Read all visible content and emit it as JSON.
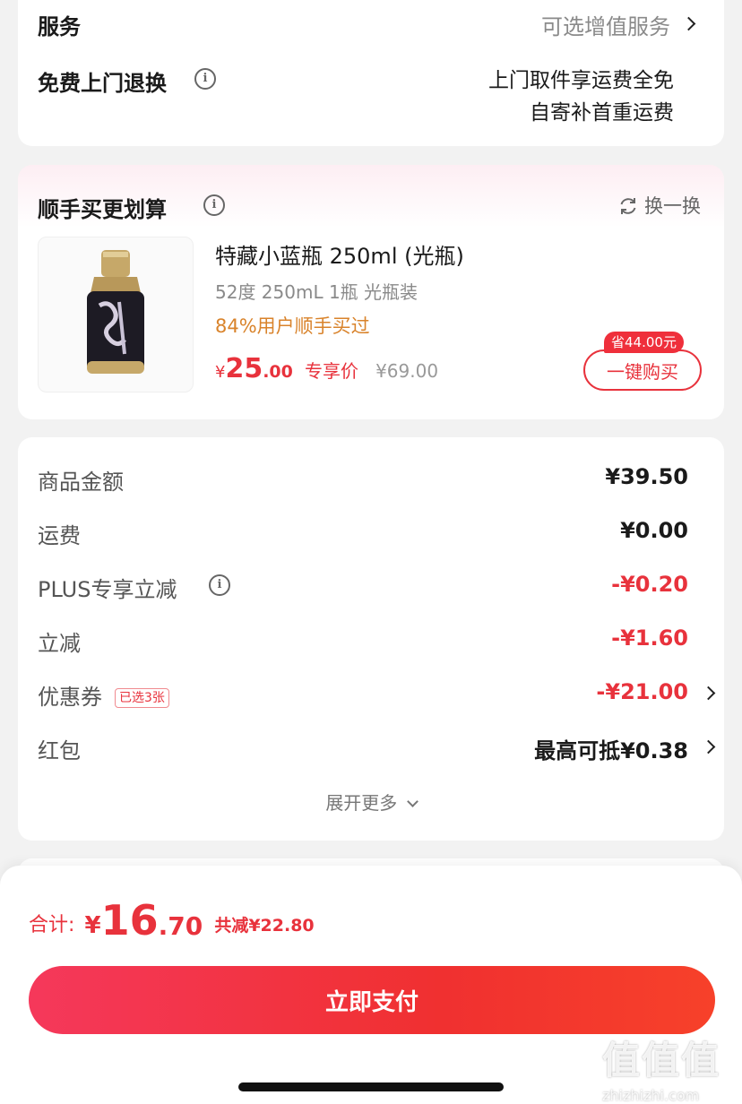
{
  "service": {
    "label": "服务",
    "value": "可选增值服务",
    "free_return_label": "免费上门退换",
    "free_return_line1": "上门取件享运费全免",
    "free_return_line2": "自寄补首重运费"
  },
  "upsell": {
    "title": "顺手买更划算",
    "refresh_label": "换一换",
    "product_name": "特藏小蓝瓶 250ml (光瓶)",
    "product_spec": "52度 250mL 1瓶 光瓶装",
    "bought_hint": "84%用户顺手买过",
    "price_symbol": "¥",
    "price_int": "25",
    "price_dec": ".00",
    "price_tag": "专享价",
    "orig_price": "¥69.00",
    "save_tag": "省44.00元",
    "buy_label": "一键购买"
  },
  "summary": {
    "rows": [
      {
        "label": "商品金额",
        "value": "¥39.50"
      },
      {
        "label": "运费",
        "value": "¥0.00"
      },
      {
        "label": "PLUS专享立减",
        "value": "-¥0.20"
      },
      {
        "label": "立减",
        "value": "-¥1.60"
      },
      {
        "label": "优惠券",
        "value": "-¥21.00",
        "badge": "已选3张"
      },
      {
        "label": "红包",
        "value": "最高可抵¥0.38"
      }
    ],
    "expand_label": "展开更多"
  },
  "total": {
    "label": "合计:",
    "symbol": "¥",
    "amount_int": "16",
    "amount_dec": ".70",
    "saved": "共减¥22.80"
  },
  "pay_button": "立即支付",
  "watermark": {
    "logo": "值",
    "site": "zhizhizhi.com"
  },
  "colors": {
    "accent": "#e8323c",
    "orange_hint": "#d9832b"
  }
}
